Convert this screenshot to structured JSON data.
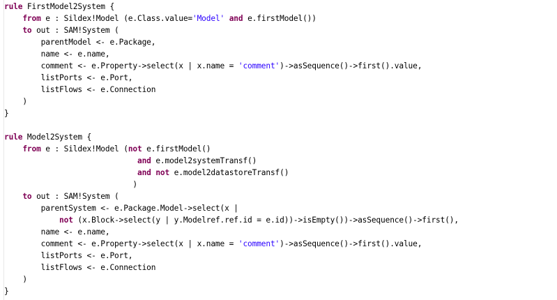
{
  "colors": {
    "background": "#ffffff",
    "keyword": "#7f0055",
    "string": "#2a00ff",
    "text": "#000000"
  },
  "code": {
    "lines": [
      [
        {
          "t": "kw",
          "v": "rule"
        },
        {
          "t": "txt",
          "v": " FirstModel2System {"
        }
      ],
      [
        {
          "t": "txt",
          "v": "    "
        },
        {
          "t": "kw",
          "v": "from"
        },
        {
          "t": "txt",
          "v": " e : Sildex!Model (e.Class.value="
        },
        {
          "t": "str",
          "v": "'Model'"
        },
        {
          "t": "txt",
          "v": " "
        },
        {
          "t": "kw",
          "v": "and"
        },
        {
          "t": "txt",
          "v": " e.firstModel())"
        }
      ],
      [
        {
          "t": "txt",
          "v": "    "
        },
        {
          "t": "kw",
          "v": "to"
        },
        {
          "t": "txt",
          "v": " out : SAM!System ("
        }
      ],
      [
        {
          "t": "txt",
          "v": "        parentModel <- e.Package,"
        }
      ],
      [
        {
          "t": "txt",
          "v": "        name <- e.name,"
        }
      ],
      [
        {
          "t": "txt",
          "v": "        comment <- e.Property->select(x | x.name = "
        },
        {
          "t": "str",
          "v": "'comment'"
        },
        {
          "t": "txt",
          "v": ")->asSequence()->first().value,"
        }
      ],
      [
        {
          "t": "txt",
          "v": "        listPorts <- e.Port,"
        }
      ],
      [
        {
          "t": "txt",
          "v": "        listFlows <- e.Connection"
        }
      ],
      [
        {
          "t": "txt",
          "v": "    )"
        }
      ],
      [
        {
          "t": "txt",
          "v": "}"
        }
      ],
      [
        {
          "t": "txt",
          "v": ""
        }
      ],
      [
        {
          "t": "kw",
          "v": "rule"
        },
        {
          "t": "txt",
          "v": " Model2System {"
        }
      ],
      [
        {
          "t": "txt",
          "v": "    "
        },
        {
          "t": "kw",
          "v": "from"
        },
        {
          "t": "txt",
          "v": " e : Sildex!Model ("
        },
        {
          "t": "kw",
          "v": "not"
        },
        {
          "t": "txt",
          "v": " e.firstModel()"
        }
      ],
      [
        {
          "t": "txt",
          "v": "                             "
        },
        {
          "t": "kw",
          "v": "and"
        },
        {
          "t": "txt",
          "v": " e.model2systemTransf()"
        }
      ],
      [
        {
          "t": "txt",
          "v": "                             "
        },
        {
          "t": "kw",
          "v": "and not"
        },
        {
          "t": "txt",
          "v": " e.model2datastoreTransf()"
        }
      ],
      [
        {
          "t": "txt",
          "v": "                            )"
        }
      ],
      [
        {
          "t": "txt",
          "v": "    "
        },
        {
          "t": "kw",
          "v": "to"
        },
        {
          "t": "txt",
          "v": " out : SAM!System ("
        }
      ],
      [
        {
          "t": "txt",
          "v": "        parentSystem <- e.Package.Model->select(x |"
        }
      ],
      [
        {
          "t": "txt",
          "v": "            "
        },
        {
          "t": "kw",
          "v": "not"
        },
        {
          "t": "txt",
          "v": " (x.Block->select(y | y.Modelref.ref.id = e.id))->isEmpty())->asSequence()->first(),"
        }
      ],
      [
        {
          "t": "txt",
          "v": "        name <- e.name,"
        }
      ],
      [
        {
          "t": "txt",
          "v": "        comment <- e.Property->select(x | x.name = "
        },
        {
          "t": "str",
          "v": "'comment'"
        },
        {
          "t": "txt",
          "v": ")->asSequence()->first().value,"
        }
      ],
      [
        {
          "t": "txt",
          "v": "        listPorts <- e.Port,"
        }
      ],
      [
        {
          "t": "txt",
          "v": "        listFlows <- e.Connection"
        }
      ],
      [
        {
          "t": "txt",
          "v": "    )"
        }
      ],
      [
        {
          "t": "txt",
          "v": "}"
        }
      ]
    ]
  }
}
